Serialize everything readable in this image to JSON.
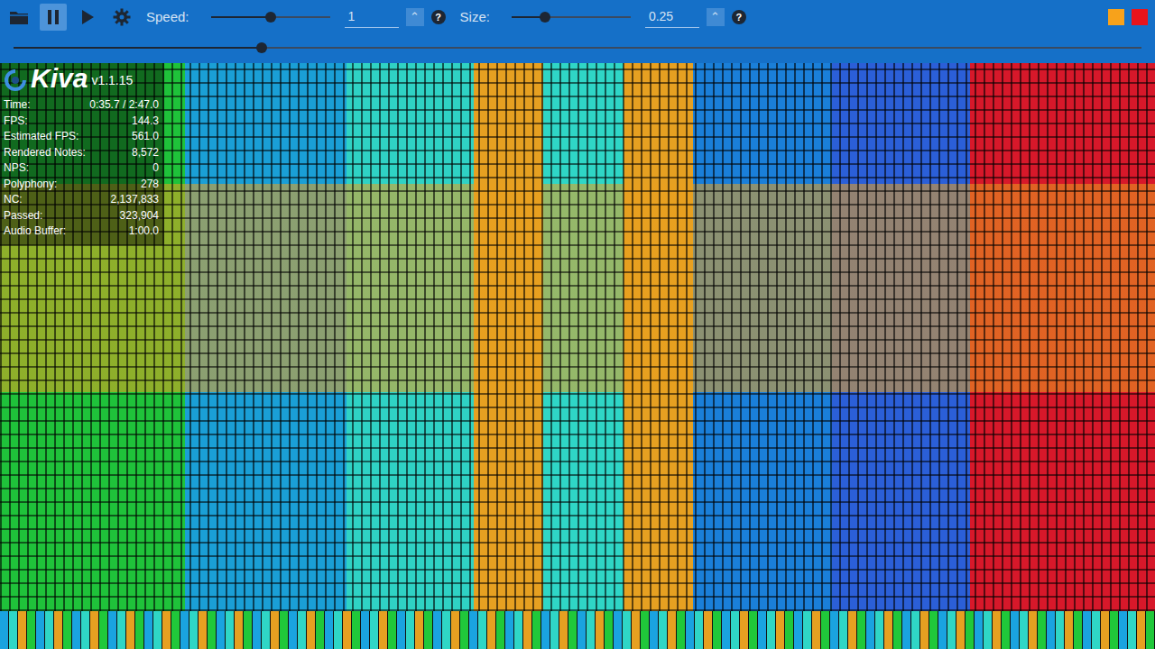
{
  "app": {
    "name": "Kiva",
    "version": "v1.1.15"
  },
  "toolbar": {
    "pause_button": {
      "selected": true
    },
    "play_button": {
      "selected": false
    },
    "speed": {
      "label": "Speed:",
      "level": 0.5,
      "value": "1",
      "spinner": "⌃",
      "help": "?"
    },
    "size": {
      "label": "Size:",
      "level": 0.28,
      "value": "0.25",
      "spinner": "⌃",
      "help": "?"
    },
    "window_buttons": [
      {
        "color": "#f7a21b"
      },
      {
        "color": "#e8141c"
      }
    ]
  },
  "seek": {
    "level": 0.22
  },
  "stats": [
    {
      "label": "Time:",
      "value": "0:35.7 / 2:47.0"
    },
    {
      "label": "FPS:",
      "value": "144.3"
    },
    {
      "label": "Estimated FPS:",
      "value": "561.0"
    },
    {
      "label": "Rendered Notes:",
      "value": "8,572"
    },
    {
      "label": "NPS:",
      "value": "0"
    },
    {
      "label": "Polyphony:",
      "value": "278"
    },
    {
      "label": "NC:",
      "value": "2,137,833"
    },
    {
      "label": "Passed:",
      "value": "323,904"
    },
    {
      "label": "Audio Buffer:",
      "value": "1:00.0"
    }
  ]
}
